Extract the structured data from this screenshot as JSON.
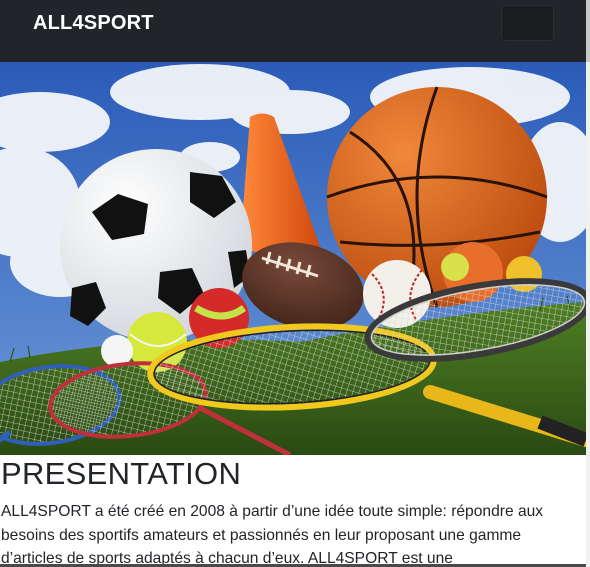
{
  "navbar": {
    "brand": "ALL4SPORT",
    "toggler_label": "Toggle navigation"
  },
  "hero": {
    "alt": "Ballons et raquettes de sport sur la pelouse",
    "colors": {
      "sky": "#3d6fc4",
      "grass": "#3f6b1d",
      "basketball": "#e06a1e",
      "cone": "#f26a1c"
    }
  },
  "presentation": {
    "title": "PRESENTATION",
    "text": "ALL4SPORT a été créé en 2008 à partir d’une idée toute simple: répondre aux besoins des sportifs amateurs et passionnés en leur proposant une gamme d’articles de sports adaptés à chacun d’eux. ALL4SPORT est une"
  }
}
